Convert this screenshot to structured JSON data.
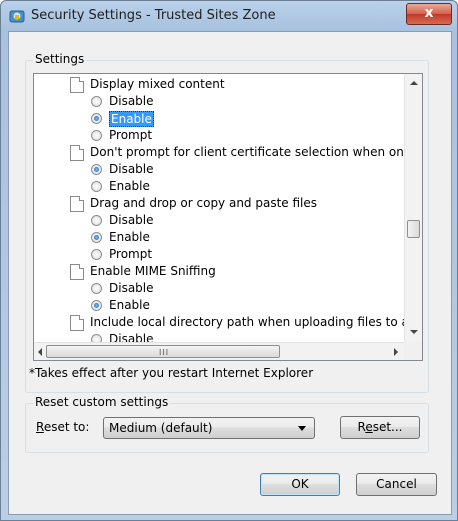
{
  "window": {
    "title": "Security Settings - Trusted Sites Zone",
    "close_label": "x"
  },
  "settings_group": {
    "label": "Settings"
  },
  "settings_tree": [
    {
      "kind": "setting",
      "label": "Display mixed content"
    },
    {
      "kind": "option",
      "label": "Disable",
      "checked": false
    },
    {
      "kind": "option",
      "label": "Enable",
      "checked": true,
      "selected": true
    },
    {
      "kind": "option",
      "label": "Prompt",
      "checked": false
    },
    {
      "kind": "setting",
      "label": "Don't prompt for client certificate selection when only one ce"
    },
    {
      "kind": "option",
      "label": "Disable",
      "checked": true
    },
    {
      "kind": "option",
      "label": "Enable",
      "checked": false
    },
    {
      "kind": "setting",
      "label": "Drag and drop or copy and paste files"
    },
    {
      "kind": "option",
      "label": "Disable",
      "checked": false
    },
    {
      "kind": "option",
      "label": "Enable",
      "checked": true
    },
    {
      "kind": "option",
      "label": "Prompt",
      "checked": false
    },
    {
      "kind": "setting",
      "label": "Enable MIME Sniffing"
    },
    {
      "kind": "option",
      "label": "Disable",
      "checked": false
    },
    {
      "kind": "option",
      "label": "Enable",
      "checked": true
    },
    {
      "kind": "setting",
      "label": "Include local directory path when uploading files to a server"
    },
    {
      "kind": "option",
      "label": "Disable",
      "checked": false
    }
  ],
  "note": "*Takes effect after you restart Internet Explorer",
  "reset_group": {
    "label": "Reset custom settings",
    "reset_to_prefix": "R",
    "reset_to_rest": "eset to:",
    "dropdown_value": "Medium (default)",
    "reset_button_prefix": "R",
    "reset_button_accel": "e",
    "reset_button_rest": "set..."
  },
  "buttons": {
    "ok": "OK",
    "cancel": "Cancel"
  },
  "colors": {
    "selection": "#3399ff",
    "close_button": "#c0392b"
  }
}
